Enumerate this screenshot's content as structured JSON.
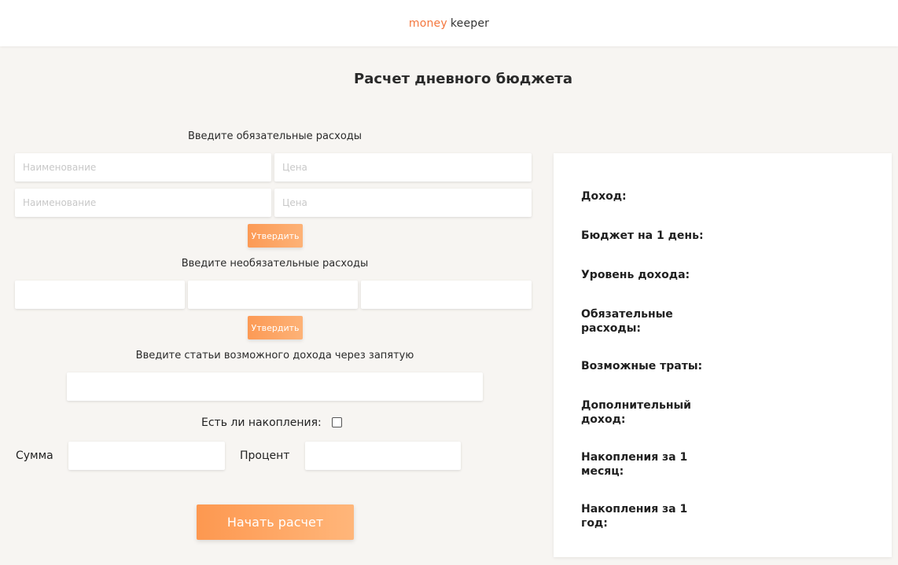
{
  "header": {
    "brand_part1": "money",
    "brand_part2": "keeper"
  },
  "page_title": "Расчет дневного бюджета",
  "mandatory": {
    "label": "Введите обязательные расходы",
    "name_placeholder": "Наименование",
    "price_placeholder": "Цена",
    "confirm_label": "Утвердить"
  },
  "optional": {
    "label": "Введите необязательные расходы",
    "confirm_label": "Утвердить"
  },
  "income": {
    "label": "Введите статьи возможного дохода через запятую"
  },
  "savings": {
    "question": "Есть ли накопления:",
    "checked": false,
    "sum_label": "Сумма",
    "percent_label": "Процент"
  },
  "start_button": "Начать расчет",
  "results": [
    "Доход:",
    "Бюджет на 1 день:",
    "Уровень дохода:",
    "Обязательные расходы:",
    "Возможные траты:",
    "Дополнительный доход:",
    "Накопления за 1 месяц:",
    "Накопления за 1 год:"
  ],
  "colors": {
    "accent": "#f4773e",
    "button_start": "#fd9850",
    "button_end": "#ffb67a"
  }
}
